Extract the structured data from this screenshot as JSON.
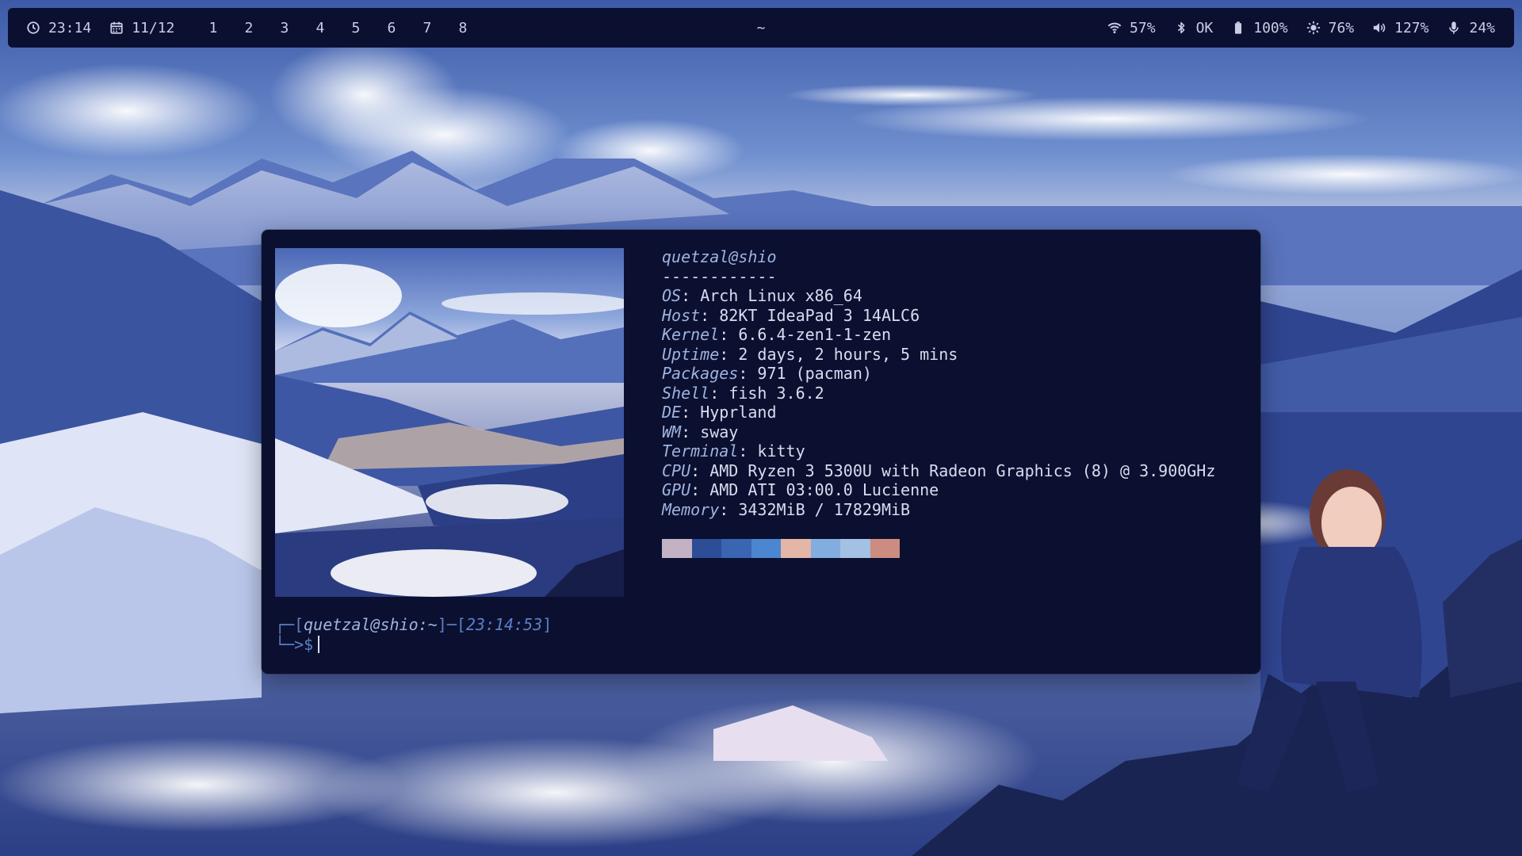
{
  "topbar": {
    "clock_icon": "clock-icon",
    "time": "23:14",
    "calendar_icon": "calendar-icon",
    "date": "11/12",
    "workspaces": [
      "1",
      "2",
      "3",
      "4",
      "5",
      "6",
      "7",
      "8"
    ],
    "window_title": "~",
    "wifi_icon": "wifi-icon",
    "wifi": "57%",
    "bluetooth_icon": "bluetooth-icon",
    "bluetooth": "OK",
    "battery_icon": "battery-icon",
    "battery": "100%",
    "brightness_icon": "brightness-icon",
    "brightness": "76%",
    "volume_icon": "volume-icon",
    "volume": "127%",
    "mic_icon": "microphone-icon",
    "mic": "24%"
  },
  "terminal": {
    "user": "quetzal",
    "at": "@",
    "host": "shio",
    "separator": "------------",
    "fields": [
      {
        "key": "OS",
        "value": "Arch Linux x86_64"
      },
      {
        "key": "Host",
        "value": "82KT IdeaPad 3 14ALC6"
      },
      {
        "key": "Kernel",
        "value": "6.6.4-zen1-1-zen"
      },
      {
        "key": "Uptime",
        "value": "2 days, 2 hours, 5 mins"
      },
      {
        "key": "Packages",
        "value": "971 (pacman)"
      },
      {
        "key": "Shell",
        "value": "fish 3.6.2"
      },
      {
        "key": "DE",
        "value": "Hyprland"
      },
      {
        "key": "WM",
        "value": "sway"
      },
      {
        "key": "Terminal",
        "value": "kitty"
      },
      {
        "key": "CPU",
        "value": "AMD Ryzen 3 5300U with Radeon Graphics (8) @ 3.900GHz"
      },
      {
        "key": "GPU",
        "value": "AMD ATI 03:00.0 Lucienne"
      },
      {
        "key": "Memory",
        "value": "3432MiB / 17829MiB"
      }
    ],
    "palette": [
      "#c2b2c4",
      "#2e4d97",
      "#3a65b3",
      "#4d86d0",
      "#e3b6a8",
      "#82aedf",
      "#a4c0e3",
      "#cc8c82"
    ],
    "prompt": {
      "open": "┌─[",
      "user": "quetzal",
      "host": "@shio",
      "path": ":~",
      "mid": "]─[",
      "time": "23:14:53",
      "close": "]",
      "line2": "└─>$"
    }
  },
  "colors": {
    "bar_bg": "#0b1030",
    "terminal_bg": "#0b1030",
    "accent": "#9fb3df",
    "text": "#d8dcf0"
  }
}
